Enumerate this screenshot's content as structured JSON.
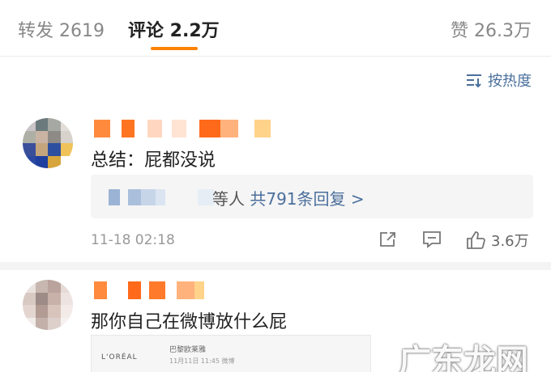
{
  "tabs": {
    "repost": "转发 2619",
    "comments": "评论 2.2万",
    "likes": "赞 26.3万"
  },
  "sort_label": "按热度",
  "comments": [
    {
      "text": "总结：屁都没说",
      "reply_who": "等人",
      "reply_count": "共791条回复 >",
      "time": "11-18 02:18",
      "like_count": "3.6万"
    },
    {
      "text": "那你自己在微博放什么屁",
      "card_logo": "L'ORÉAL",
      "card_brand": "巴黎欧莱雅",
      "card_sub": "11月11日 11:45 微博"
    }
  ],
  "watermark": "广东龙网",
  "colors": {
    "accent": "#ff8200",
    "link": "#4a6f9c"
  }
}
